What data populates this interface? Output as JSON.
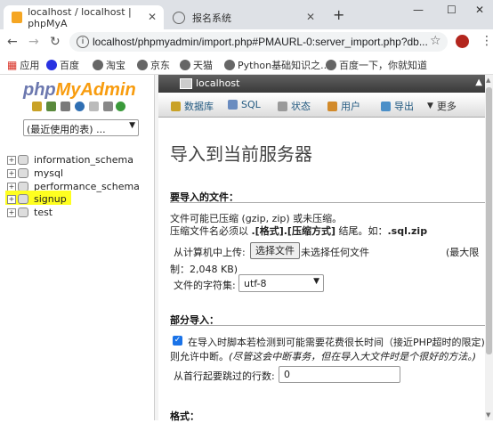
{
  "browser": {
    "tabs": [
      {
        "title": "localhost / localhost | phpMyA",
        "active": true
      },
      {
        "title": "报名系统",
        "active": false
      }
    ],
    "new_tab": "+",
    "url": "localhost/phpmyadmin/import.php#PMAURL-0:server_import.php?db...",
    "bookmarks": [
      "应用",
      "百度",
      "淘宝",
      "京东",
      "天猫",
      "Python基础知识之...",
      "百度一下，你就知道"
    ]
  },
  "sidebar": {
    "logo_php": "php",
    "logo_myadmin": "MyAdmin",
    "recent_select": "(最近使用的表) ...",
    "databases": [
      "information_schema",
      "mysql",
      "performance_schema",
      "signup",
      "test"
    ],
    "highlighted": "signup"
  },
  "main": {
    "server": "localhost",
    "tabs": [
      "数据库",
      "SQL",
      "状态",
      "用户",
      "导出",
      "更多"
    ],
    "title": "导入到当前服务器",
    "file_section": {
      "heading": "要导入的文件：",
      "line1": "文件可能已压缩 (gzip, zip) 或未压缩。",
      "line2a": "压缩文件名必须以 ",
      "line2b": ".[格式].[压缩方式]",
      "line2c": " 结尾。如：",
      "line2d": ".sql.zip",
      "upload_label": "从计算机中上传:",
      "choose_button": "选择文件",
      "no_file": "未选择任何文件",
      "max_label": "(最大限",
      "max_value": "制：2,048 KB)",
      "charset_label": "文件的字符集:",
      "charset_value": "utf-8"
    },
    "partial_section": {
      "heading": "部分导入：",
      "allow_interrupt": "在导入时脚本若检测到可能需要花费很长时间（接近PHP超时的限定)",
      "allow_interrupt2": "则允许中断。",
      "allow_interrupt_note": "(尽管这会中断事务，但在导入大文件时是个很好的方法。)",
      "skip_label": "从首行起要跳过的行数:",
      "skip_value": "0"
    },
    "format_heading": "格式："
  }
}
